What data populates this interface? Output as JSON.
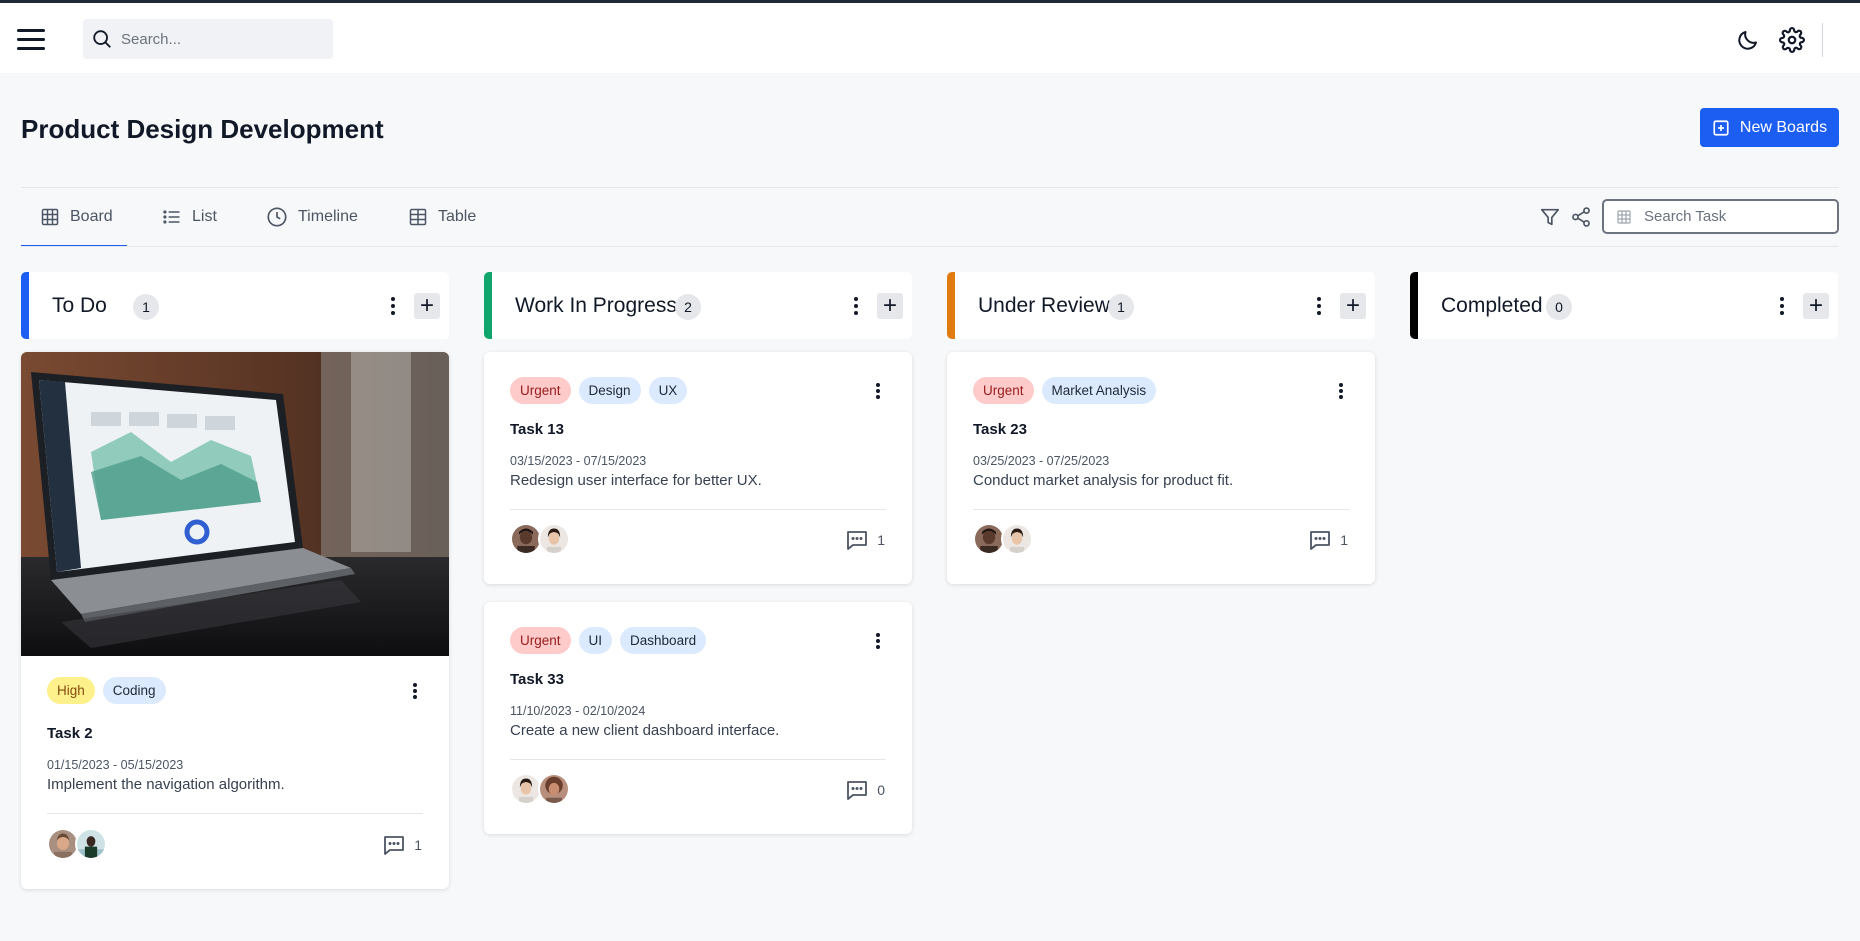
{
  "header": {
    "search_placeholder": "Search..."
  },
  "page": {
    "title": "Product Design Development",
    "new_button_label": "New Boards"
  },
  "tabs": [
    {
      "label": "Board",
      "active": true
    },
    {
      "label": "List"
    },
    {
      "label": "Timeline"
    },
    {
      "label": "Table"
    }
  ],
  "task_search_placeholder": "Search Task",
  "colors": {
    "accent": "#1d5ef2",
    "todo": "#1d5ef2",
    "wip": "#10a56a",
    "review": "#e07b10",
    "completed": "#000000"
  },
  "columns": [
    {
      "title": "To Do",
      "count": "1"
    },
    {
      "title": "Work In Progress",
      "count": "2"
    },
    {
      "title": "Under Review",
      "count": "1"
    },
    {
      "title": "Completed",
      "count": "0"
    }
  ],
  "cards": {
    "task2": {
      "tags": [
        "High",
        "Coding"
      ],
      "name": "Task 2",
      "dates": "01/15/2023 - 05/15/2023",
      "desc": "Implement the navigation algorithm.",
      "comments": "1"
    },
    "task13": {
      "tags": [
        "Urgent",
        "Design",
        "UX"
      ],
      "name": "Task 13",
      "dates": "03/15/2023 - 07/15/2023",
      "desc": "Redesign user interface for better UX.",
      "comments": "1"
    },
    "task33": {
      "tags": [
        "Urgent",
        "UI",
        "Dashboard"
      ],
      "name": "Task 33",
      "dates": "11/10/2023 - 02/10/2024",
      "desc": "Create a new client dashboard interface.",
      "comments": "0"
    },
    "task23": {
      "tags": [
        "Urgent",
        "Market Analysis"
      ],
      "name": "Task 23",
      "dates": "03/25/2023 - 07/25/2023",
      "desc": "Conduct market analysis for product fit.",
      "comments": "1"
    }
  }
}
